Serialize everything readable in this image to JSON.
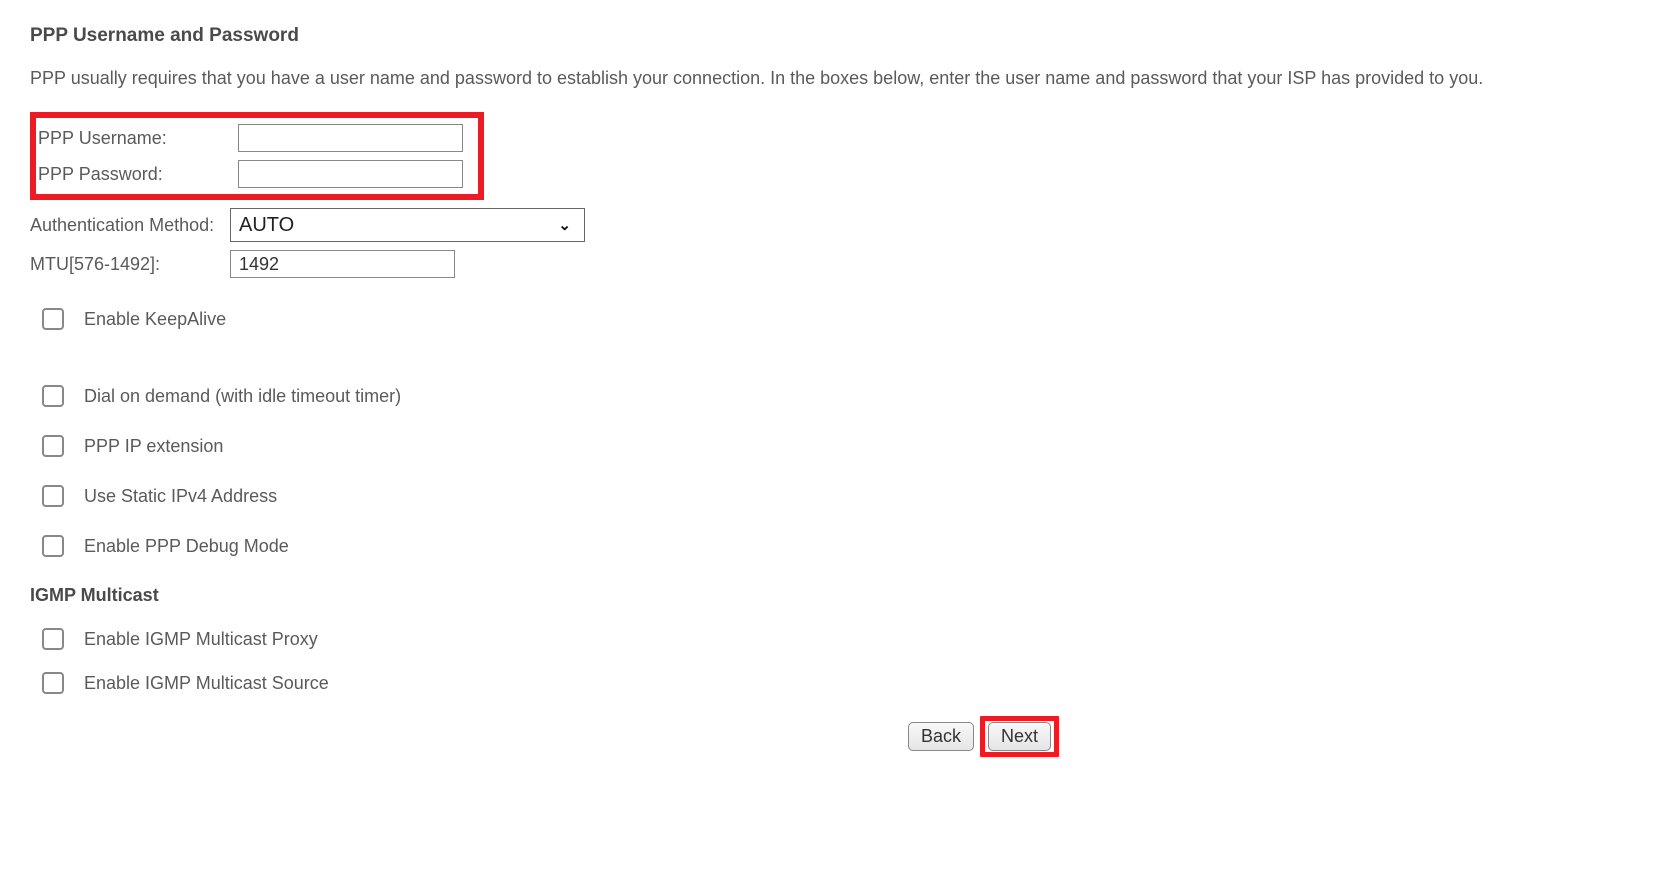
{
  "heading": "PPP Username and Password",
  "description": "PPP usually requires that you have a user name and password to establish your connection. In the boxes below, enter the user name and password that your ISP has provided to you.",
  "fields": {
    "username_label": "PPP Username:",
    "username_value": "",
    "password_label": "PPP Password:",
    "password_value": "",
    "auth_label": "Authentication Method:",
    "auth_value": "AUTO",
    "mtu_label": "MTU[576-1492]:",
    "mtu_value": "1492"
  },
  "checkboxes": {
    "keepalive": "Enable KeepAlive",
    "dial_on_demand": "Dial on demand (with idle timeout timer)",
    "ppp_ip_ext": "PPP IP extension",
    "static_ipv4": "Use Static IPv4 Address",
    "debug_mode": "Enable PPP Debug Mode"
  },
  "igmp": {
    "heading": "IGMP Multicast",
    "proxy": "Enable IGMP Multicast Proxy",
    "source": "Enable IGMP Multicast Source"
  },
  "buttons": {
    "back": "Back",
    "next": "Next"
  }
}
